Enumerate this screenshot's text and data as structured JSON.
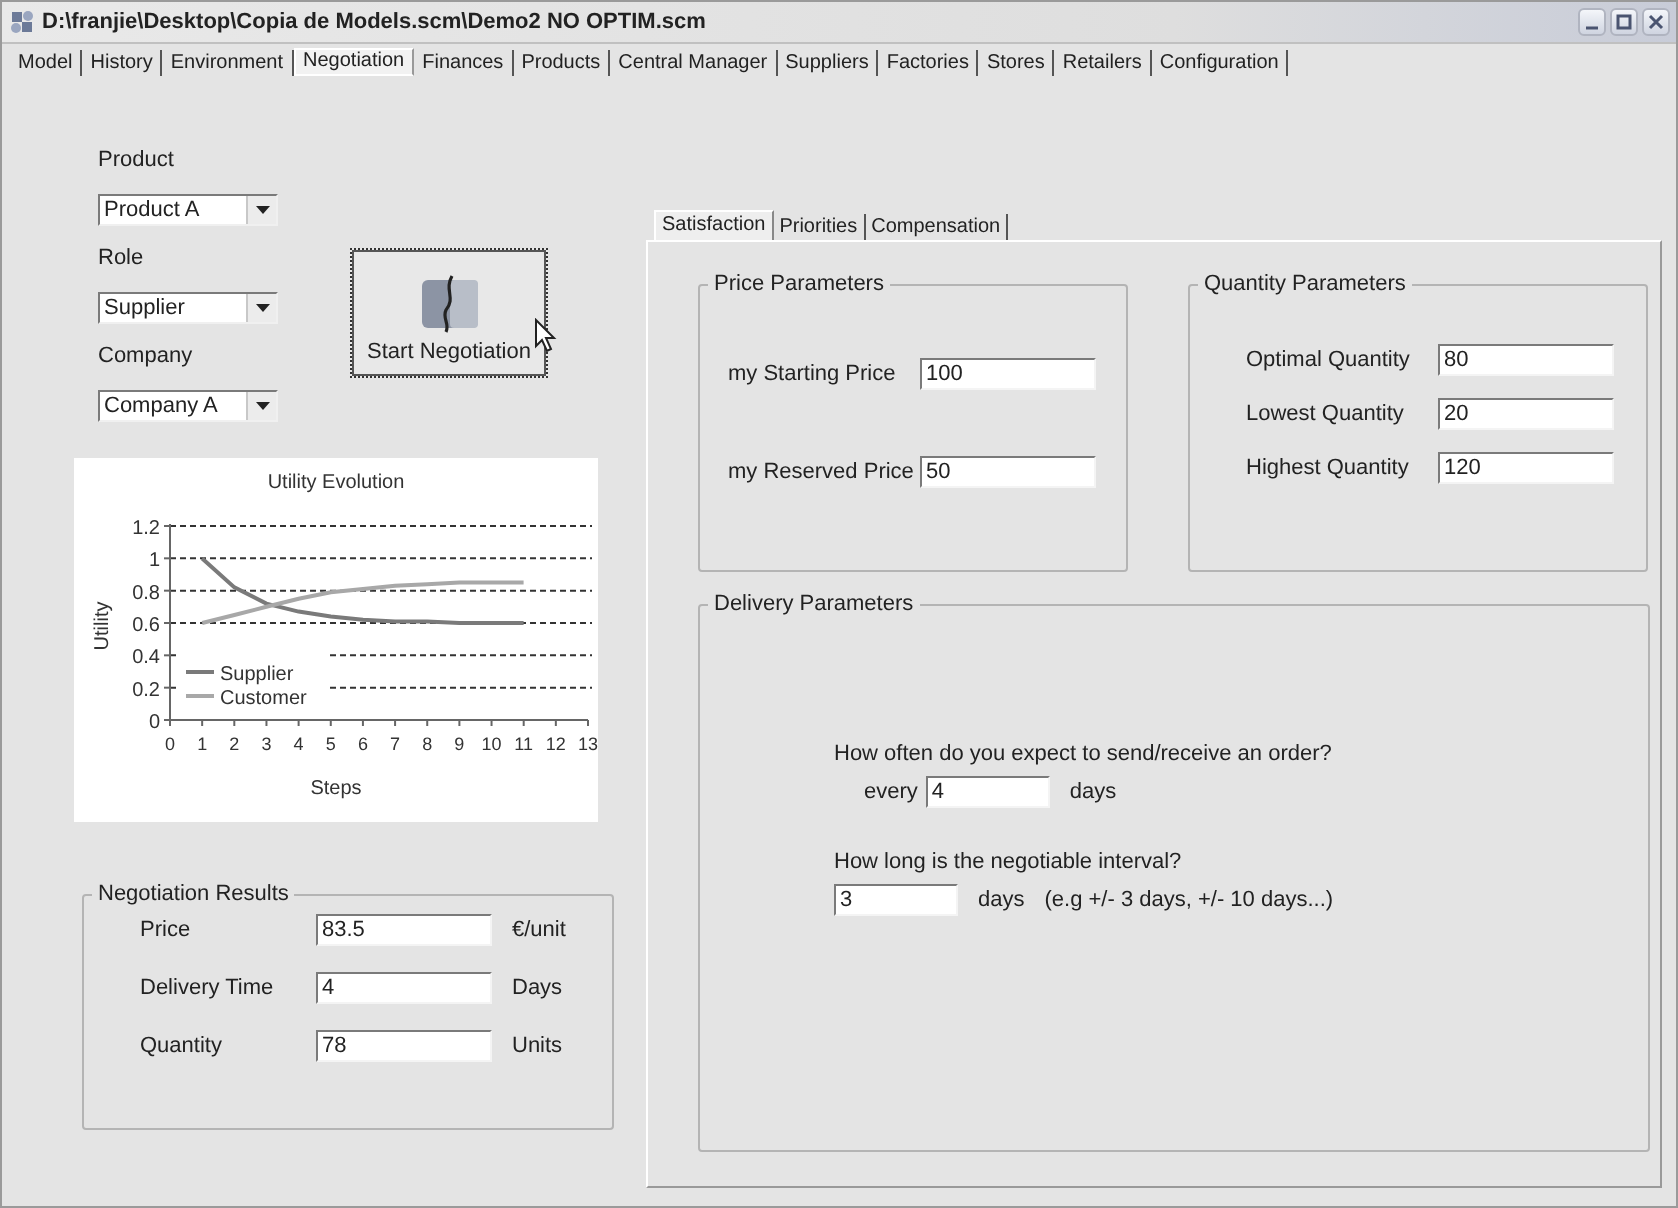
{
  "window": {
    "title": "D:\\franjie\\Desktop\\Copia de Models.scm\\Demo2 NO OPTIM.scm"
  },
  "tabs": [
    {
      "label": "Model",
      "selected": false
    },
    {
      "label": "History",
      "selected": false
    },
    {
      "label": "Environment",
      "selected": false
    },
    {
      "label": "Negotiation",
      "selected": true
    },
    {
      "label": "Finances",
      "selected": false
    },
    {
      "label": "Products",
      "selected": false
    },
    {
      "label": "Central Manager",
      "selected": false
    },
    {
      "label": "Suppliers",
      "selected": false
    },
    {
      "label": "Factories",
      "selected": false
    },
    {
      "label": "Stores",
      "selected": false
    },
    {
      "label": "Retailers",
      "selected": false
    },
    {
      "label": "Configuration",
      "selected": false
    }
  ],
  "selectors": [
    {
      "label": "Product",
      "value": "Product A"
    },
    {
      "label": "Role",
      "value": "Supplier"
    },
    {
      "label": "Company",
      "value": "Company A"
    }
  ],
  "start_button": {
    "label": "Start Negotiation"
  },
  "chart": {
    "chart_data": {
      "type": "line",
      "title": "Utility Evolution",
      "xlabel": "Steps",
      "ylabel": "Utility",
      "x": [
        1,
        2,
        3,
        4,
        5,
        6,
        7,
        8,
        9,
        10,
        11
      ],
      "series": [
        {
          "name": "Supplier",
          "color": "#7a7a7a",
          "values": [
            1,
            0.82,
            0.72,
            0.67,
            0.64,
            0.62,
            0.61,
            0.61,
            0.6,
            0.6,
            0.6
          ]
        },
        {
          "name": "Customer",
          "color": "#a8a8a8",
          "values": [
            0.6,
            0.65,
            0.7,
            0.75,
            0.79,
            0.81,
            0.83,
            0.84,
            0.85,
            0.85,
            0.85
          ]
        }
      ],
      "grid": true,
      "legend": true,
      "xlim": [
        0,
        13
      ],
      "ylim": [
        0,
        1.2
      ],
      "xticks": [
        0,
        1,
        2,
        3,
        4,
        5,
        6,
        7,
        8,
        9,
        10,
        11,
        12,
        13
      ],
      "yticks": [
        0,
        0.2,
        0.4,
        0.6,
        0.8,
        1,
        1.2
      ]
    }
  },
  "results": {
    "title": "Negotiation Results",
    "rows": [
      {
        "label": "Price",
        "value": "83.5",
        "unit": "€/unit"
      },
      {
        "label": "Delivery Time",
        "value": "4",
        "unit": "Days"
      },
      {
        "label": "Quantity",
        "value": "78",
        "unit": "Units"
      }
    ]
  },
  "sub_tabs": [
    {
      "label": "Satisfaction",
      "selected": true
    },
    {
      "label": "Priorities",
      "selected": false
    },
    {
      "label": "Compensation",
      "selected": false
    }
  ],
  "price_parameters": {
    "title": "Price Parameters",
    "fields": [
      {
        "label": "my Starting Price",
        "value": "100"
      },
      {
        "label": "my Reserved Price",
        "value": "50"
      }
    ]
  },
  "quantity_parameters": {
    "title": "Quantity Parameters",
    "fields": [
      {
        "label": "Optimal Quantity",
        "value": "80"
      },
      {
        "label": "Lowest Quantity",
        "value": "20"
      },
      {
        "label": "Highest Quantity",
        "value": "120"
      }
    ]
  },
  "delivery_parameters": {
    "title": "Delivery Parameters",
    "frequency": {
      "question": "How often do you expect to send/receive an order?",
      "prefix": "every",
      "value": "4",
      "unit": "days"
    },
    "interval": {
      "question": "How long is the negotiable interval?",
      "value": "3",
      "unit": "days",
      "hint": "(e.g +/- 3 days, +/- 10 days...)"
    }
  }
}
